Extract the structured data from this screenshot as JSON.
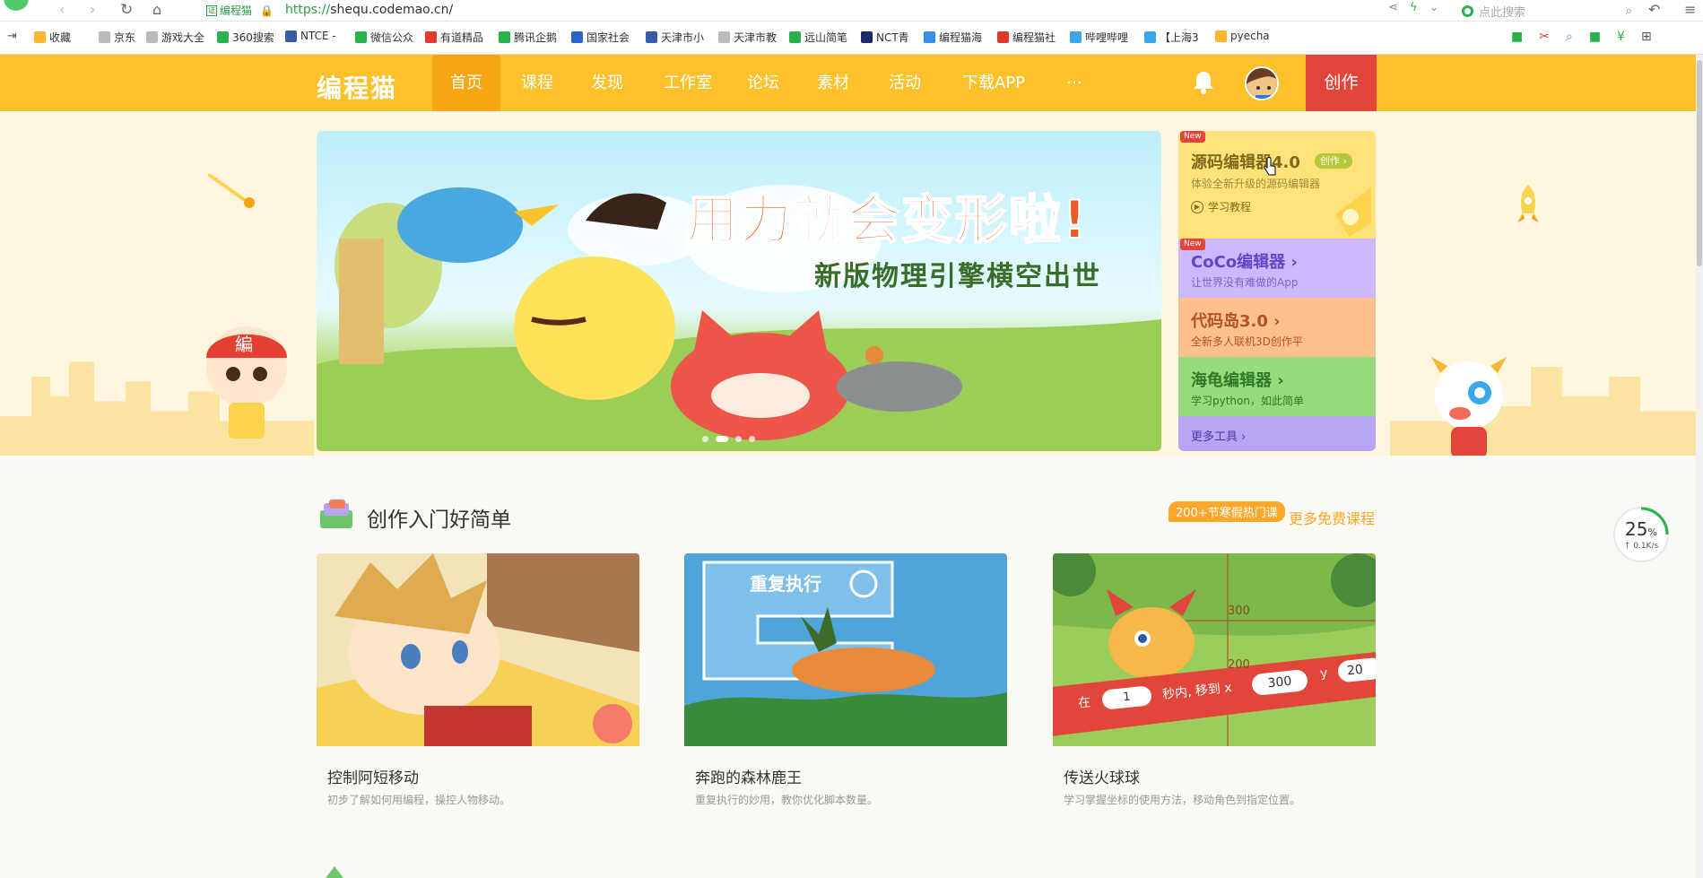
{
  "browser": {
    "cert_label": "编程猫",
    "url_scheme": "https://",
    "url_rest": "shequ.codemao.cn/",
    "search_placeholder": "点此搜索",
    "bookmarks": [
      {
        "label": "收藏",
        "color": "#f7b731"
      },
      {
        "label": "京东",
        "color": "#bbbbbb"
      },
      {
        "label": "游戏大全",
        "color": "#bbbbbb"
      },
      {
        "label": "360搜索",
        "color": "#2ab24a"
      },
      {
        "label": "NTCE -",
        "color": "#3a5aa8"
      },
      {
        "label": "微信公众",
        "color": "#2ab24a"
      },
      {
        "label": "有道精品",
        "color": "#e0392e"
      },
      {
        "label": "腾讯企鹅",
        "color": "#2ab24a"
      },
      {
        "label": "国家社会",
        "color": "#2a64c8"
      },
      {
        "label": "天津市小",
        "color": "#3a5aa8"
      },
      {
        "label": "天津市教",
        "color": "#bbbbbb"
      },
      {
        "label": "远山简笔",
        "color": "#2ab24a"
      },
      {
        "label": "NCT青",
        "color": "#1c2c6a"
      },
      {
        "label": "编程猫海",
        "color": "#3a8ee8"
      },
      {
        "label": "编程猫社",
        "color": "#e0392e"
      },
      {
        "label": "哔哩哔哩",
        "color": "#3aa8e8"
      },
      {
        "label": "【上海3",
        "color": "#3aa8e8"
      },
      {
        "label": "pyecha",
        "color": "#f7b731"
      }
    ]
  },
  "nav": {
    "logo": "编程猫",
    "items": [
      "首页",
      "课程",
      "发现",
      "工作室",
      "论坛",
      "素材",
      "活动",
      "下载APP",
      "···"
    ],
    "create": "创作"
  },
  "banner": {
    "title": "用力就会变形啦!",
    "subtitle": "新版物理引擎横空出世"
  },
  "tools": [
    {
      "name": "源码编辑器4.0",
      "desc": "体验全新升级的源码编辑器",
      "extra": "学习教程",
      "badge": "创作 ›",
      "new": "New",
      "bg": "#ffe37a",
      "color": "#7f6a1b"
    },
    {
      "name": "CoCo编辑器 ›",
      "desc": "让世界没有难做的App",
      "new": "New",
      "bg": "#cdb8ff",
      "color": "#6346c8"
    },
    {
      "name": "代码岛3.0 ›",
      "desc": "全新多人联机3D创作平",
      "bg": "#ffc08f",
      "color": "#b5531f"
    },
    {
      "name": "海龟编辑器 ›",
      "desc": "学习python，如此简单",
      "bg": "#98db7c",
      "color": "#2f7a25"
    },
    {
      "name": "更多工具 ›",
      "bg": "#b8a4f4",
      "color": "#4d3aa6"
    }
  ],
  "section": {
    "title": "创作入门好简单",
    "promo": "200+节寒假热门课",
    "more": "更多免费课程"
  },
  "cards": [
    {
      "title": "控制阿短移动",
      "desc": "初步了解如何用编程，操控人物移动。"
    },
    {
      "title": "奔跑的森林鹿王",
      "desc": "重复执行的妙用，教你优化脚本数量。",
      "block": "重复执行"
    },
    {
      "title": "传送火球球",
      "desc": "学习掌握坐标的使用方法，移动角色到指定位置。",
      "block_pre": "在",
      "v1": "1",
      "block_mid": "秒内, 移到 x",
      "v2": "300",
      "block_y": "y",
      "v3": "20",
      "t300": "300",
      "t200": "200"
    }
  ],
  "speed": {
    "pct": "25",
    "unit": "%",
    "rate": "↑ 0.1K/s"
  }
}
